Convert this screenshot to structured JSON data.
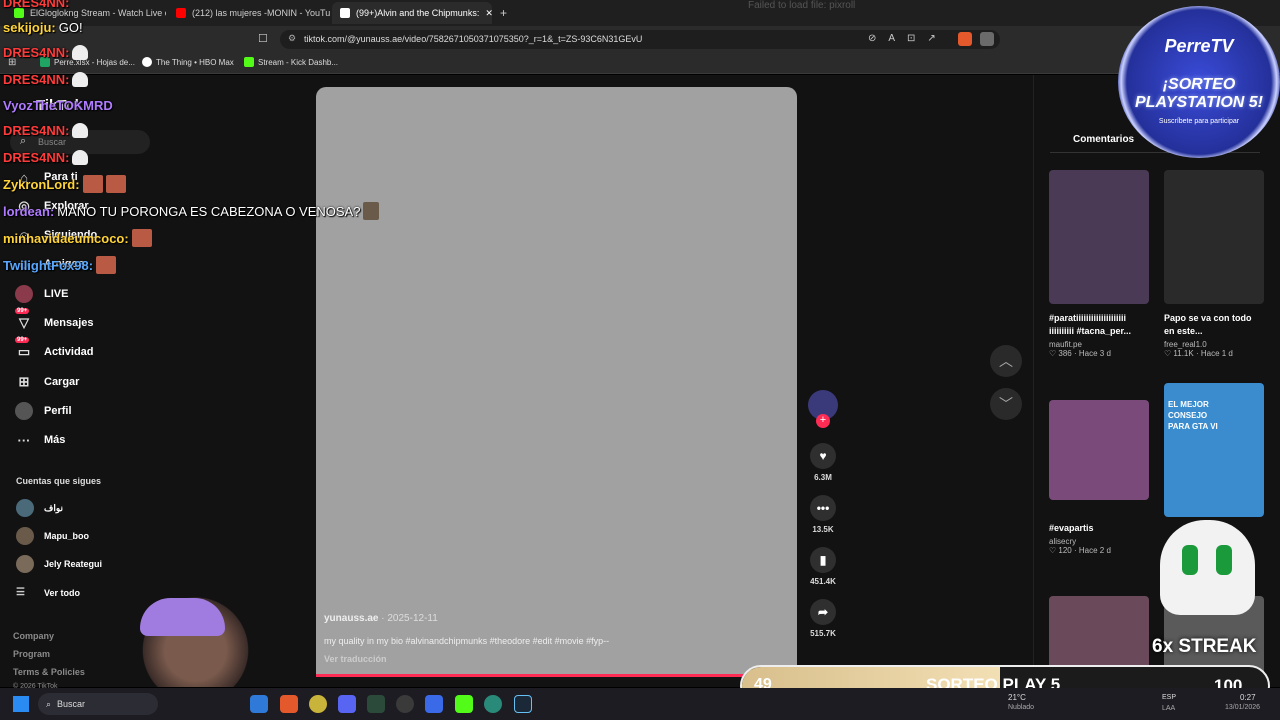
{
  "browser": {
    "tabs": [
      {
        "label": "ElGloglokng Stream - Watch Live on",
        "color": "#53fc18"
      },
      {
        "label": "(212) las mujeres -MONIN - YouTube",
        "color": "#ff0000"
      },
      {
        "label": "(99+)Alvin and the Chipmunks:",
        "color": "#ffffff"
      }
    ],
    "new_tab_glyph": "+",
    "url": "tiktok.com/@yunauss.ae/video/7582671050371075350?_r=1&_t=ZS-93C6N31GEvU",
    "bookmarks": [
      "Perre.xlsx - Hojas de...",
      "The Thing • HBO Max",
      "Stream - Kick Dashb..."
    ],
    "faded_text": "Failed to load file: pixroll"
  },
  "tiktok": {
    "brand": "TikTok",
    "search_placeholder": "Buscar",
    "nav": [
      {
        "label": "Para ti",
        "icon": "home-icon"
      },
      {
        "label": "Explorar",
        "icon": "compass-icon"
      },
      {
        "label": "Siguiendo",
        "icon": "following-icon"
      },
      {
        "label": "Amigos",
        "icon": "friends-icon"
      },
      {
        "label": "LIVE",
        "icon": "live-icon"
      },
      {
        "label": "Mensajes",
        "icon": "message-icon",
        "badge": "99+"
      },
      {
        "label": "Actividad",
        "icon": "activity-icon",
        "badge": "99+"
      },
      {
        "label": "Cargar",
        "icon": "upload-icon"
      },
      {
        "label": "Perfil",
        "icon": "profile-icon"
      },
      {
        "label": "Más",
        "icon": "more-icon"
      }
    ],
    "following_header": "Cuentas que sigues",
    "following": [
      "نواف",
      "Mapu_boo",
      "Jely Reategui"
    ],
    "see_all": "Ver todo",
    "footer": [
      "Company",
      "Program",
      "Terms & Policies",
      "© 2026 TikTok"
    ],
    "video": {
      "author": "yunauss.ae",
      "date": "· 2025-12-11",
      "caption": "my quality in my bio #alvinandchipmunks #theodore #edit #movie #fyp--",
      "translate": "Ver traducción"
    },
    "actions": {
      "likes": "6.3M",
      "comments": "13.5K",
      "saves": "451.4K",
      "shares": "515.7K"
    },
    "comments_tab": "Comentarios",
    "related": [
      {
        "title": "#paratiiiiiiiiiiiiiiiiiiii iiiiiiiiii #tacna_per...",
        "author": "maufit.pe",
        "likes": "386",
        "when": "· Hace 3 d",
        "color": "#4a3a55"
      },
      {
        "title": "Papo se va con todo en este...",
        "author": "free_real1.0",
        "likes": "11.1K",
        "when": "· Hace 1 d",
        "color": "#2a2a2a"
      },
      {
        "title": "#evapartis",
        "author": "alisecry",
        "likes": "120",
        "when": "· Hace 2 d",
        "color": "#7a4a7a"
      },
      {
        "title": "EL MEJOR CONSEJO PARA GTA VI",
        "author": "",
        "likes": "",
        "when": "",
        "color": "#3a8ccf"
      }
    ]
  },
  "chat": [
    {
      "user": "DRES4NN:",
      "color": "#ff3b3b",
      "msg": ""
    },
    {
      "user": "sekijoju:",
      "color": "#ffd43a",
      "msg": "GO!"
    },
    {
      "user": "DRES4NN:",
      "color": "#ff3b3b",
      "msg": ""
    },
    {
      "user": "DRES4NN:",
      "color": "#ff3b3b",
      "msg": ""
    },
    {
      "user": "VyozTheTOKMRD",
      "color": "#b07cff",
      "msg": ""
    },
    {
      "user": "DRES4NN:",
      "color": "#ff3b3b",
      "msg": ""
    },
    {
      "user": "DRES4NN:",
      "color": "#ff3b3b",
      "msg": ""
    },
    {
      "user": "ZykronLord:",
      "color": "#ffd43a",
      "msg": ""
    },
    {
      "user": "lordean:",
      "color": "#b07cff",
      "msg": "MANO TU PORONGA ES CABEZONA O VENOSA?"
    },
    {
      "user": "minhavidaeumcoco:",
      "color": "#ffd43a",
      "msg": ""
    },
    {
      "user": "TwilightFox98:",
      "color": "#5aa7ff",
      "msg": ""
    }
  ],
  "overlay": {
    "brand": "PerreTV",
    "raffle": "¡SORTEO PLAYSTATION 5!",
    "subscribe": "Suscríbete para participar",
    "bar_left": "49",
    "bar_title": "SORTEO PLAY 5",
    "bar_right": "100",
    "progress": 0.49,
    "streak": "6x STREAK"
  },
  "taskbar": {
    "search": "Buscar",
    "temp": "21°C",
    "weather": "Nublado",
    "lang": "ESP",
    "lang2": "LAA",
    "time": "0:27",
    "date": "13/01/2026"
  },
  "colors": {
    "accent": "#fe2c55",
    "kick": "#53fc18"
  }
}
